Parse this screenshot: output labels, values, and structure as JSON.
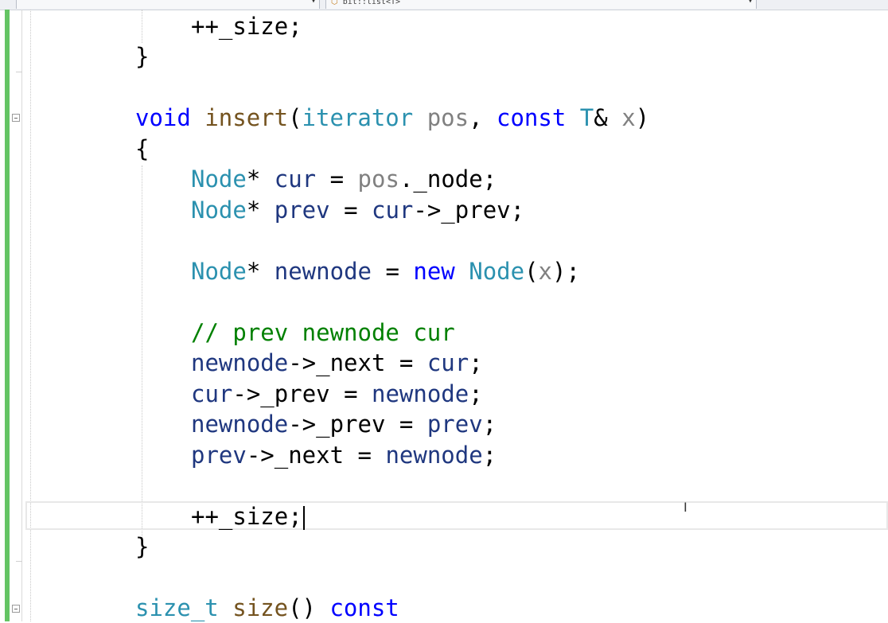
{
  "toolbar": {
    "member_dropdown_value": "",
    "scope_dropdown_value": "bit::list<T>"
  },
  "editor": {
    "lines": [
      {
        "id": "l0",
        "tokens": [
          [
            "op",
            "++_size;"
          ]
        ]
      },
      {
        "id": "l1",
        "tokens": [
          [
            "op",
            "}"
          ]
        ]
      },
      {
        "id": "l2",
        "tokens": []
      },
      {
        "id": "l3",
        "tokens": [
          [
            "kw",
            "void"
          ],
          [
            "op",
            " "
          ],
          [
            "fn",
            "insert"
          ],
          [
            "op",
            "("
          ],
          [
            "ty",
            "iterator"
          ],
          [
            "op",
            " "
          ],
          [
            "pm",
            "pos"
          ],
          [
            "op",
            ", "
          ],
          [
            "kw",
            "const"
          ],
          [
            "op",
            " "
          ],
          [
            "ty",
            "T"
          ],
          [
            "op",
            "& "
          ],
          [
            "pm",
            "x"
          ],
          [
            "op",
            ")"
          ]
        ]
      },
      {
        "id": "l4",
        "tokens": [
          [
            "op",
            "{"
          ]
        ]
      },
      {
        "id": "l5",
        "tokens": [
          [
            "ty",
            "Node"
          ],
          [
            "op",
            "* "
          ],
          [
            "vr",
            "cur"
          ],
          [
            "op",
            " = "
          ],
          [
            "pm",
            "pos"
          ],
          [
            "op",
            "._node;"
          ]
        ]
      },
      {
        "id": "l6",
        "tokens": [
          [
            "ty",
            "Node"
          ],
          [
            "op",
            "* "
          ],
          [
            "vr",
            "prev"
          ],
          [
            "op",
            " = "
          ],
          [
            "vr",
            "cur"
          ],
          [
            "op",
            "->_prev;"
          ]
        ]
      },
      {
        "id": "l7",
        "tokens": []
      },
      {
        "id": "l8",
        "tokens": [
          [
            "ty",
            "Node"
          ],
          [
            "op",
            "* "
          ],
          [
            "vr",
            "newnode"
          ],
          [
            "op",
            " = "
          ],
          [
            "kw",
            "new"
          ],
          [
            "op",
            " "
          ],
          [
            "ty",
            "Node"
          ],
          [
            "op",
            "("
          ],
          [
            "pm",
            "x"
          ],
          [
            "op",
            ");"
          ]
        ]
      },
      {
        "id": "l9",
        "tokens": []
      },
      {
        "id": "l10",
        "tokens": [
          [
            "cm",
            "// prev newnode cur"
          ]
        ]
      },
      {
        "id": "l11",
        "tokens": [
          [
            "vr",
            "newnode"
          ],
          [
            "op",
            "->_next = "
          ],
          [
            "vr",
            "cur"
          ],
          [
            "op",
            ";"
          ]
        ]
      },
      {
        "id": "l12",
        "tokens": [
          [
            "vr",
            "cur"
          ],
          [
            "op",
            "->_prev = "
          ],
          [
            "vr",
            "newnode"
          ],
          [
            "op",
            ";"
          ]
        ]
      },
      {
        "id": "l13",
        "tokens": [
          [
            "vr",
            "newnode"
          ],
          [
            "op",
            "->_prev = "
          ],
          [
            "vr",
            "prev"
          ],
          [
            "op",
            ";"
          ]
        ]
      },
      {
        "id": "l14",
        "tokens": [
          [
            "vr",
            "prev"
          ],
          [
            "op",
            "->_next = "
          ],
          [
            "vr",
            "newnode"
          ],
          [
            "op",
            ";"
          ]
        ]
      },
      {
        "id": "l15",
        "tokens": []
      },
      {
        "id": "l16",
        "tokens": [
          [
            "op",
            "++_size;"
          ]
        ]
      },
      {
        "id": "l17",
        "tokens": [
          [
            "op",
            "}"
          ]
        ]
      },
      {
        "id": "l18",
        "tokens": []
      },
      {
        "id": "l19",
        "tokens": [
          [
            "ty",
            "size_t"
          ],
          [
            "op",
            " "
          ],
          [
            "fn",
            "size"
          ],
          [
            "op",
            "() "
          ],
          [
            "kw",
            "const"
          ]
        ]
      }
    ]
  },
  "colors": {
    "keyword": "#0000ff",
    "type": "#2b91af",
    "function": "#74531f",
    "parameter": "#808080",
    "local": "#1f377f",
    "comment": "#008000",
    "changed_margin": "#64c464"
  },
  "icons": {
    "fold": "minus-box-icon",
    "cursor": "text-ibeam-icon",
    "dropdown": "chevron-down-icon"
  }
}
